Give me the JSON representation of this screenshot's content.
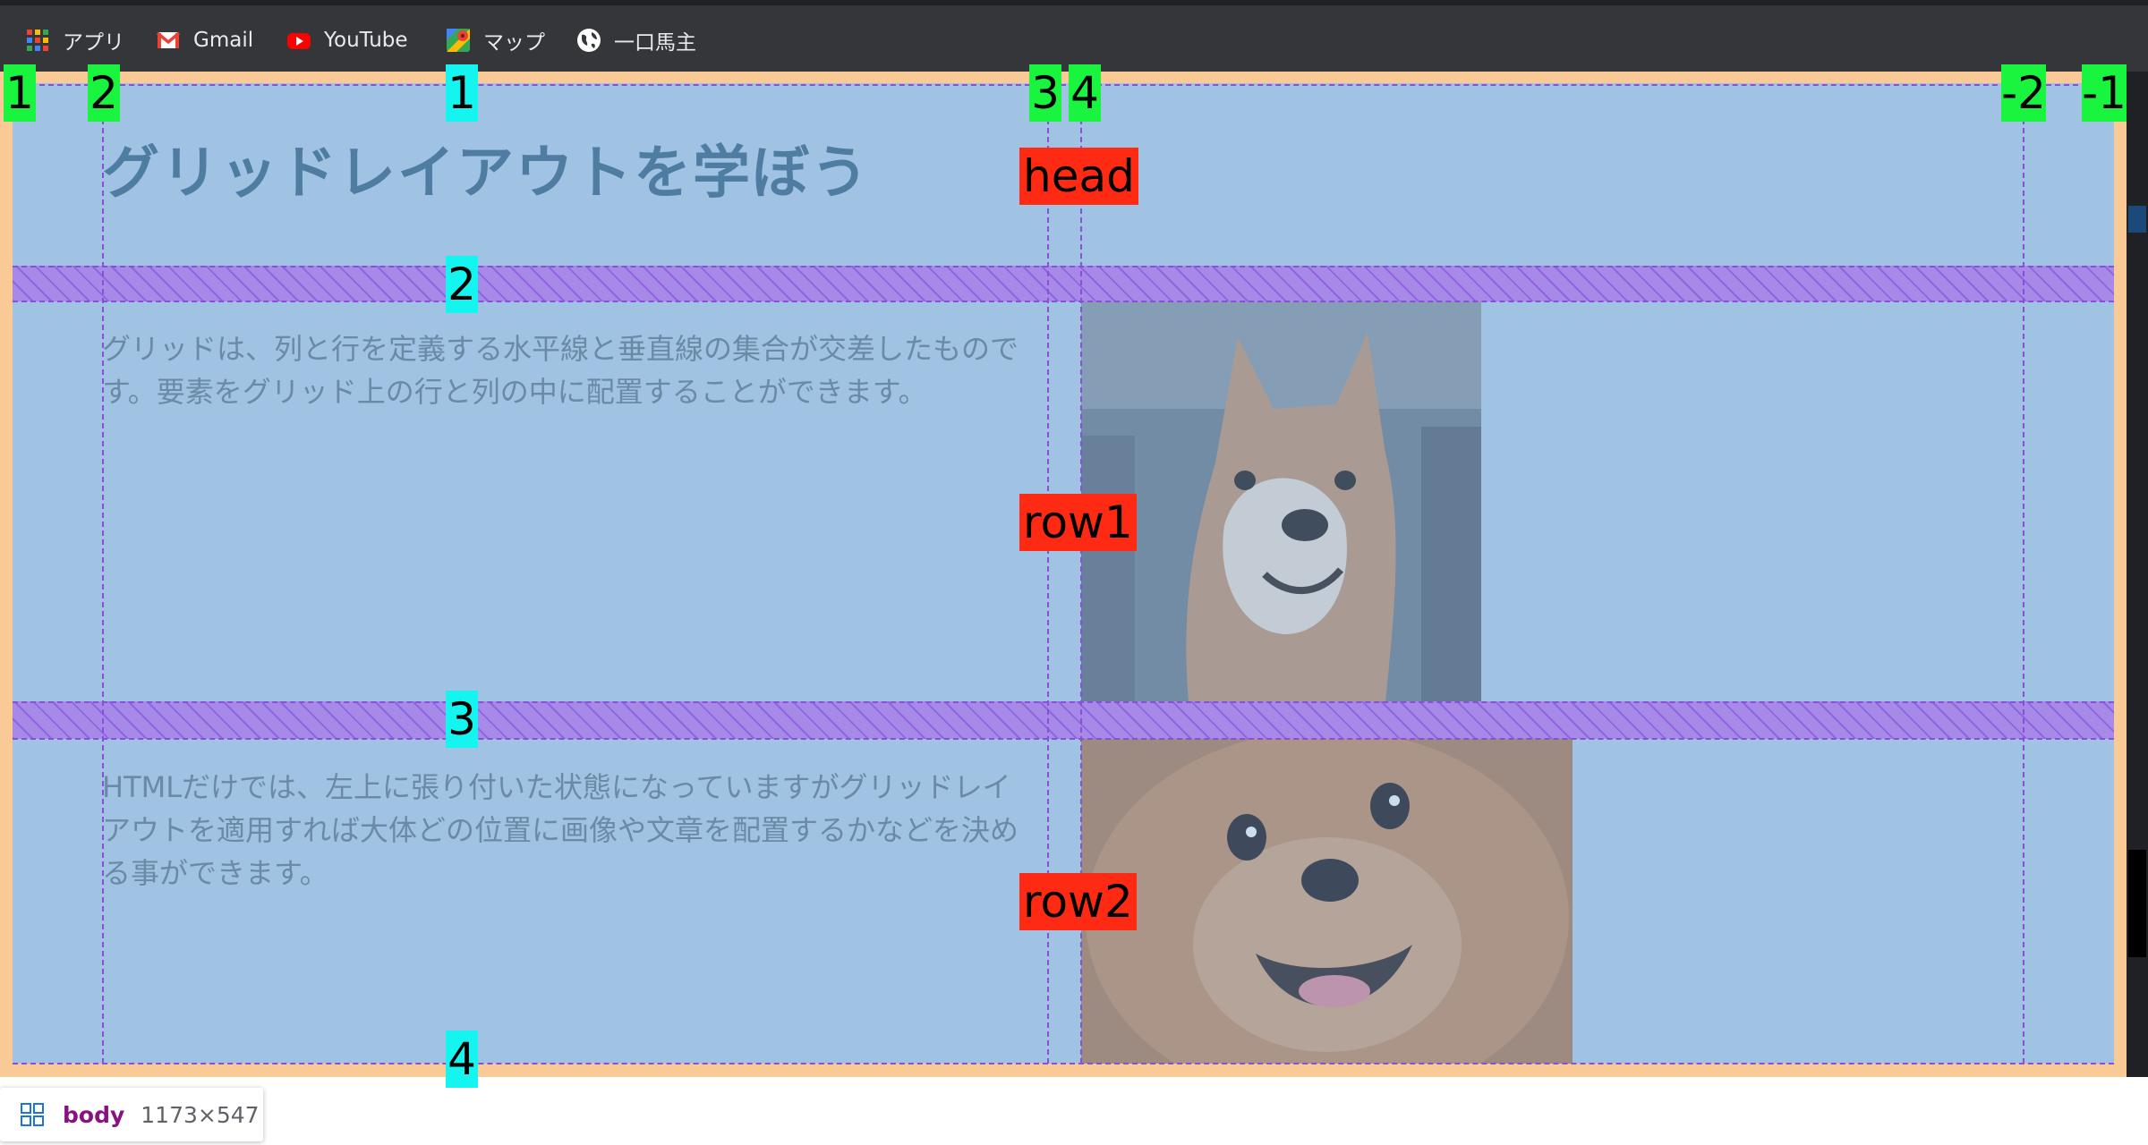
{
  "bookmarks": [
    {
      "label": "アプリ",
      "icon": "apps-grid-icon"
    },
    {
      "label": "Gmail",
      "icon": "gmail-icon"
    },
    {
      "label": "YouTube",
      "icon": "youtube-icon"
    },
    {
      "label": "マップ",
      "icon": "maps-icon"
    },
    {
      "label": "一口馬主",
      "icon": "globe-icon"
    }
  ],
  "page": {
    "title": "グリッドレイアウトを学ぼう",
    "paragraph1": "グリッドは、列と行を定義する水平線と垂直線の集合が交差したものです。要素をグリッド上の行と列の中に配置することができます。",
    "paragraph2": "HTMLだけでは、左上に張り付いた状態になっていますがグリッドレイアウトを適用すれば大体どの位置に画像や文章を配置するかなどを決める事ができます。",
    "images": [
      "shiba-inu-dog-photo",
      "pomeranian-dog-photo"
    ]
  },
  "grid_overlay": {
    "area_names": [
      "head",
      "row1",
      "row2"
    ],
    "column_line_numbers": [
      "1",
      "2",
      "3",
      "4",
      "-2",
      "-1"
    ],
    "row_line_numbers": [
      "1",
      "2",
      "3",
      "4"
    ]
  },
  "inspector_tooltip": {
    "element": "body",
    "dimensions": "1173×547"
  },
  "colors": {
    "grid_background": "#a0c3e4",
    "body_margin": "#f9c996",
    "gap_hatch": "#a78ae8",
    "area_label": "#ff2a13",
    "column_number": "#19f43f",
    "row_number": "#14f5f0"
  }
}
